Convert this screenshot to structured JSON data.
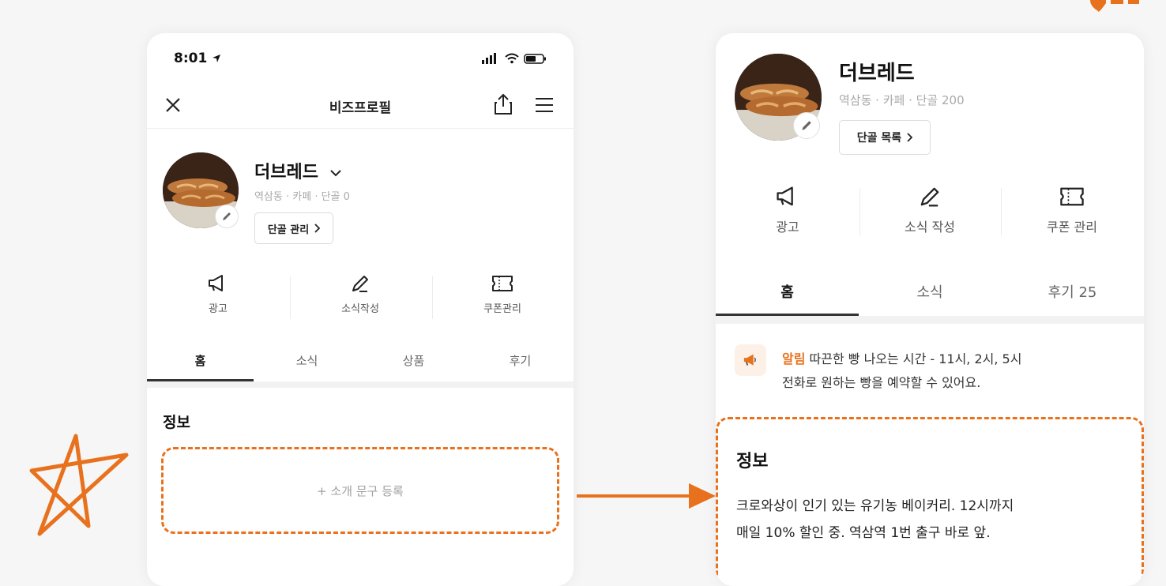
{
  "left_phone": {
    "status": {
      "time": "8:01"
    },
    "nav": {
      "title": "비즈프로필"
    },
    "profile": {
      "name": "더브레드",
      "meta": "역삼동 · 카페 · 단골 0",
      "chip_label": "단골 관리"
    },
    "actions": [
      {
        "label": "광고",
        "icon": "megaphone-icon"
      },
      {
        "label": "소식작성",
        "icon": "pencil-icon"
      },
      {
        "label": "쿠폰관리",
        "icon": "coupon-icon"
      }
    ],
    "tabs": [
      {
        "label": "홈",
        "active": true
      },
      {
        "label": "소식",
        "active": false
      },
      {
        "label": "상품",
        "active": false
      },
      {
        "label": "후기",
        "active": false
      }
    ],
    "info": {
      "heading": "정보",
      "add_intro_label": "+ 소개 문구 등록"
    }
  },
  "right_phone": {
    "profile": {
      "name": "더브레드",
      "meta": "역삼동 · 카페 · 단골 200",
      "chip_label": "단골 목록"
    },
    "actions": [
      {
        "label": "광고",
        "icon": "megaphone-icon"
      },
      {
        "label": "소식 작성",
        "icon": "pencil-icon"
      },
      {
        "label": "쿠폰 관리",
        "icon": "coupon-icon"
      }
    ],
    "tabs": [
      {
        "label": "홈",
        "active": true
      },
      {
        "label": "소식",
        "active": false
      },
      {
        "label": "후기 25",
        "active": false
      }
    ],
    "notice": {
      "tag": "알림",
      "line1": "따끈한 빵 나오는 시간 - 11시, 2시, 5시",
      "line2": "전화로 원하는 빵을 예약할 수 있어요."
    },
    "info": {
      "heading": "정보",
      "line1": "크로와상이 인기 있는 유기농 베이커리. 12시까지",
      "line2": "매일 10% 할인 중. 역삼역 1번 출구 바로 앞."
    }
  },
  "colors": {
    "accent": "#e8711e",
    "text": "#222222",
    "muted": "#a9a9a9"
  }
}
